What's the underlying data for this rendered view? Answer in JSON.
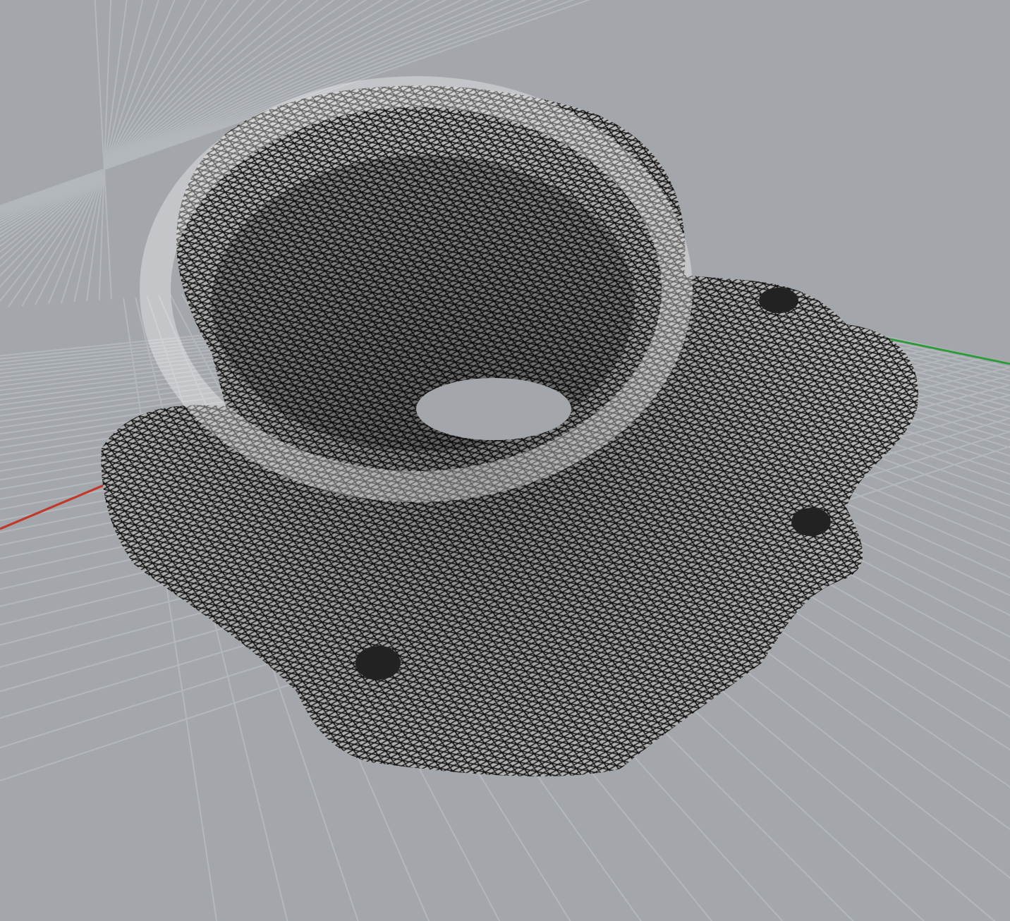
{
  "viewport": {
    "axes": [
      {
        "kind": "x",
        "color": "#c0392b"
      },
      {
        "kind": "y",
        "color": "#2e9a3a"
      }
    ]
  }
}
